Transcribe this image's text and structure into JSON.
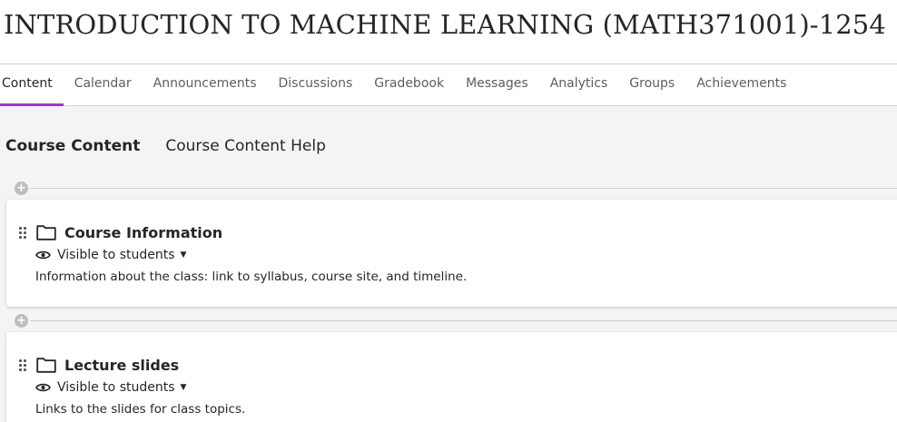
{
  "course": {
    "title": "INTRODUCTION TO MACHINE LEARNING (MATH371001)-1254"
  },
  "tabs": [
    {
      "label": "Content",
      "active": true
    },
    {
      "label": "Calendar"
    },
    {
      "label": "Announcements"
    },
    {
      "label": "Discussions"
    },
    {
      "label": "Gradebook"
    },
    {
      "label": "Messages"
    },
    {
      "label": "Analytics"
    },
    {
      "label": "Groups"
    },
    {
      "label": "Achievements"
    }
  ],
  "subnav": {
    "course_content": "Course Content",
    "help": "Course Content Help"
  },
  "items": [
    {
      "title": "Course Information",
      "visibility": "Visible to students",
      "description": "Information about the class: link to syllabus, course site, and timeline."
    },
    {
      "title": "Lecture slides",
      "visibility": "Visible to students",
      "description": "Links to the slides for class topics."
    }
  ],
  "icons": {
    "add": "plus-icon",
    "drag": "drag-handle-icon",
    "folder": "folder-icon",
    "visibility": "eye-icon",
    "dropdown": "caret-down-icon"
  },
  "colors": {
    "accent": "#9c3dc4",
    "background": "#f4f4f4",
    "card": "#ffffff",
    "text": "#262626"
  }
}
